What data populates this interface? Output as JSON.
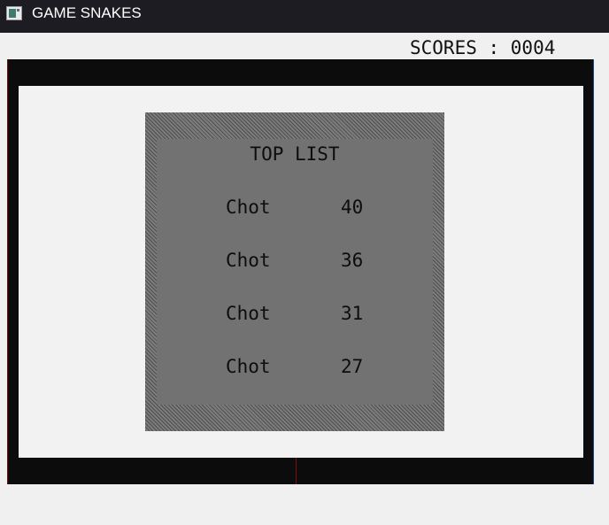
{
  "window": {
    "title": "GAME SNAKES",
    "icon": "app-window-icon"
  },
  "header": {
    "scores_text": "SCORES : 0004"
  },
  "toplist": {
    "title": "TOP LIST",
    "entries": [
      {
        "name": "Chot",
        "score": "40"
      },
      {
        "name": "Chot",
        "score": "36"
      },
      {
        "name": "Chot",
        "score": "31"
      },
      {
        "name": "Chot",
        "score": "27"
      }
    ]
  },
  "colors": {
    "titlebar": "#1c1c22",
    "board_border": "#0c0c0c",
    "play_area": "#f2f2f2",
    "panel": "#727272"
  }
}
